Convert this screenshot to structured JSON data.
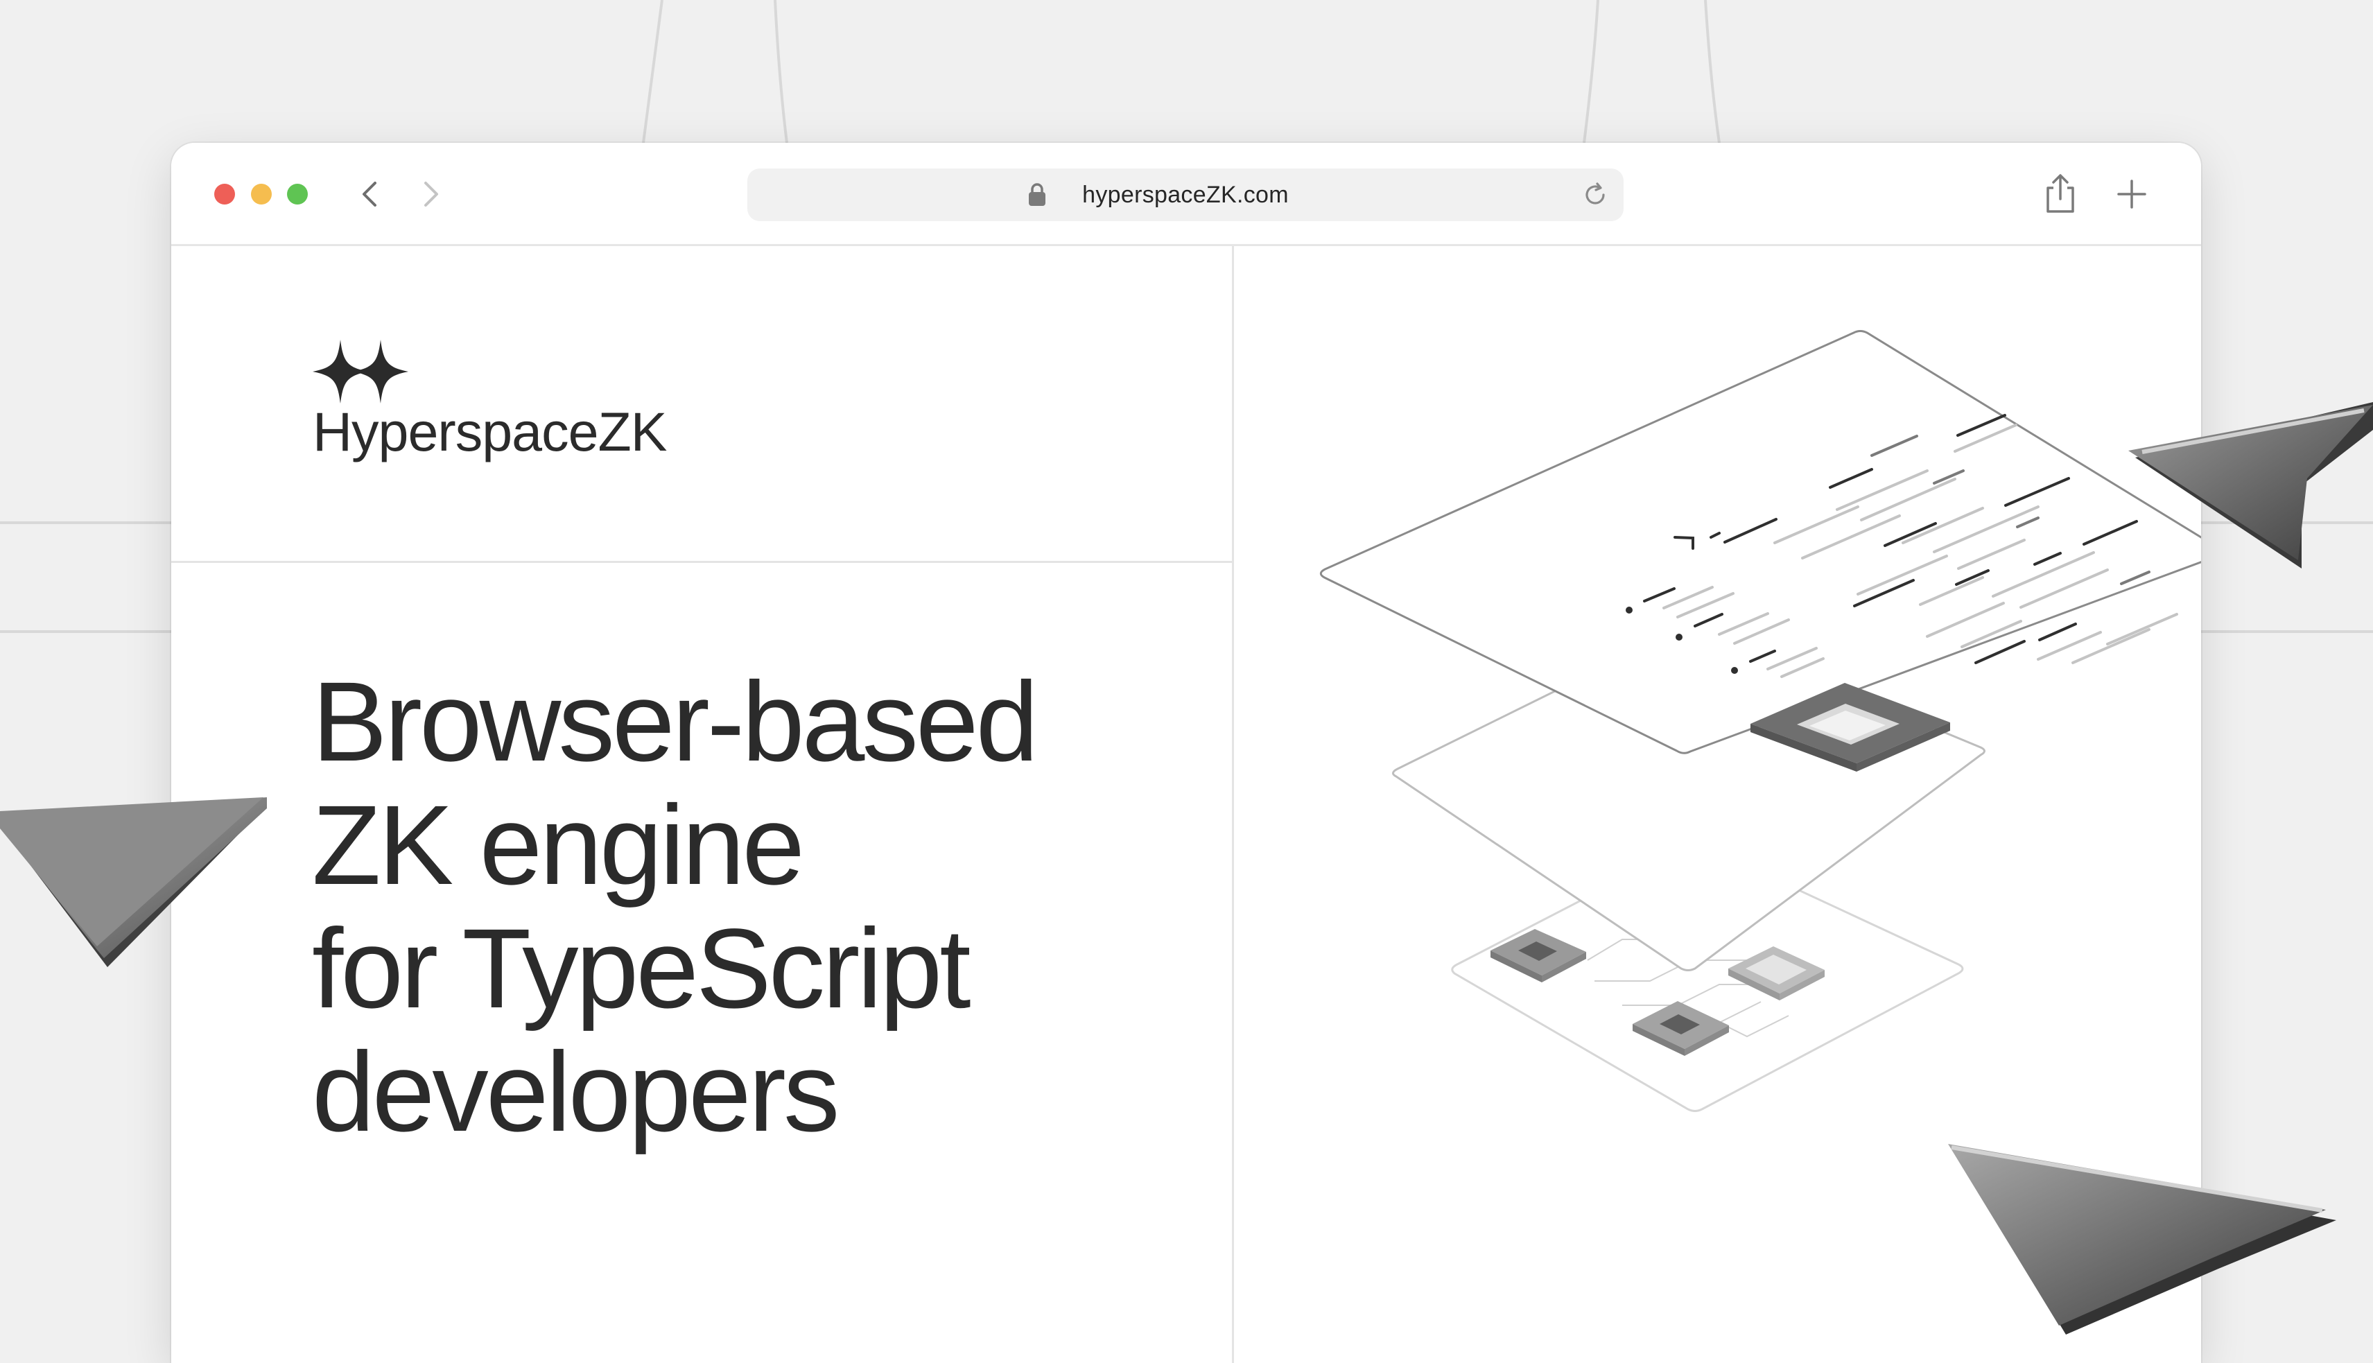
{
  "browser": {
    "url": "hyperspaceZK.com",
    "colors": {
      "close": "#ee5f57",
      "minimize": "#f5bd4f",
      "zoom": "#5fc453"
    }
  },
  "brand": {
    "name": "HyperspaceZK",
    "logo_icon": "double-sparkle-icon"
  },
  "hero": {
    "headline_lines": [
      "Browser-based",
      "ZK engine",
      "for TypeScript",
      "developers"
    ]
  },
  "illustration": {
    "layers": [
      "code-layer",
      "chip-layer",
      "circuit-layer"
    ]
  }
}
